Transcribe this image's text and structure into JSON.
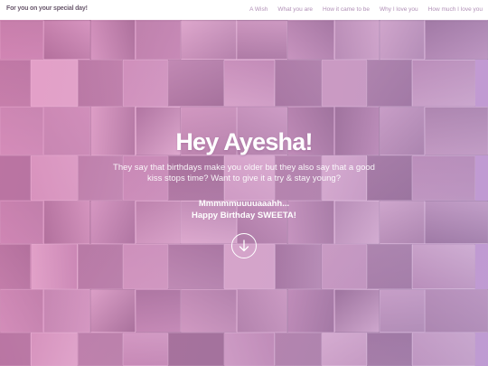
{
  "brand": {
    "title": "For you on your special day!"
  },
  "nav": {
    "items": [
      {
        "label": "A Wish"
      },
      {
        "label": "What you are"
      },
      {
        "label": "How it came to be"
      },
      {
        "label": "Why I love you"
      },
      {
        "label": "How much I love you"
      }
    ]
  },
  "hero": {
    "title": "Hey Ayesha!",
    "subtitle": "They say that birthdays make you older but they also say that a good kiss stops time? Want to give it a try & stay young?",
    "message_line1": "Mmmmmuuuuaaahh...",
    "message_line2": "Happy Birthday SWEETA!",
    "scroll_icon": "arrow-down-circle-icon"
  },
  "colors": {
    "overlay_pink": "#e980be",
    "overlay_lavender": "#b496d7",
    "nav_text": "#b08fb6",
    "brand_text": "#6b5a6e"
  }
}
